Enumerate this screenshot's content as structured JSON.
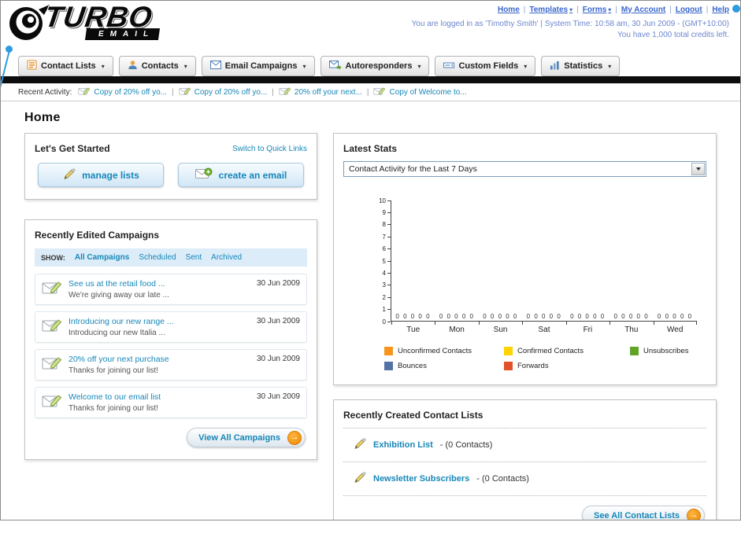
{
  "colors": {
    "accent": "#1787b8",
    "link_blue": "#3a66cc",
    "info_blue": "#6d86cf",
    "orange": "#f7941d",
    "bar_black": "#0d0d0d"
  },
  "header": {
    "logo_top": "TURBO",
    "logo_bottom": "EMAIL",
    "links": [
      {
        "label": "Home"
      },
      {
        "label": "Templates",
        "dropdown": true
      },
      {
        "label": "Forms",
        "dropdown": true
      },
      {
        "label": "My Account"
      },
      {
        "label": "Logout"
      },
      {
        "label": "Help"
      }
    ],
    "login_info": "You are logged in as 'Timothy Smith' | System Time: 10:58 am, 30 Jun 2009 - (GMT+10:00)",
    "credits": "You have 1,000 total credits left."
  },
  "nav": {
    "items": [
      {
        "label": "Contact Lists",
        "icon": "contact-lists-icon"
      },
      {
        "label": "Contacts",
        "icon": "contacts-icon"
      },
      {
        "label": "Email Campaigns",
        "icon": "email-campaigns-icon"
      },
      {
        "label": "Autoresponders",
        "icon": "autoresponders-icon"
      },
      {
        "label": "Custom Fields",
        "icon": "custom-fields-icon"
      },
      {
        "label": "Statistics",
        "icon": "statistics-icon"
      }
    ]
  },
  "activity": {
    "label": "Recent Activity:",
    "items": [
      "Copy of 20% off yo...",
      "Copy of 20% off yo...",
      "20% off your next...",
      "Copy of Welcome to..."
    ]
  },
  "page": {
    "title": "Home"
  },
  "get_started": {
    "title": "Let's Get Started",
    "switch_link": "Switch to Quick Links",
    "manage_lists_label": "manage lists",
    "create_email_label": "create an email"
  },
  "campaigns": {
    "title": "Recently Edited Campaigns",
    "show_label": "SHOW:",
    "tabs": [
      "All Campaigns",
      "Scheduled",
      "Sent",
      "Archived"
    ],
    "items": [
      {
        "title": "See us at the retail food ...",
        "subtitle": "We're giving away our late ...",
        "date": "30 Jun 2009"
      },
      {
        "title": "Introducing our new range ...",
        "subtitle": "Introducing our new Italia ...",
        "date": "30 Jun 2009"
      },
      {
        "title": "20% off your next purchase",
        "subtitle": "Thanks for joining our list!",
        "date": "30 Jun 2009"
      },
      {
        "title": "Welcome to our email list",
        "subtitle": "Thanks for joining our list!",
        "date": "30 Jun 2009"
      }
    ],
    "view_all_label": "View All Campaigns"
  },
  "stats": {
    "title": "Latest Stats",
    "dropdown_value": "Contact Activity for the Last 7 Days"
  },
  "chart_data": {
    "type": "bar",
    "title": "Contact Activity for the Last 7 Days",
    "categories": [
      "Tue",
      "Mon",
      "Sun",
      "Sat",
      "Fri",
      "Thu",
      "Wed"
    ],
    "series": [
      {
        "name": "Unconfirmed Contacts",
        "color": "#f7941d",
        "values": [
          0,
          0,
          0,
          0,
          0,
          0,
          0
        ]
      },
      {
        "name": "Confirmed Contacts",
        "color": "#ffd200",
        "values": [
          0,
          0,
          0,
          0,
          0,
          0,
          0
        ]
      },
      {
        "name": "Unsubscribes",
        "color": "#61a427",
        "values": [
          0,
          0,
          0,
          0,
          0,
          0,
          0
        ]
      },
      {
        "name": "Bounces",
        "color": "#5572a7",
        "values": [
          0,
          0,
          0,
          0,
          0,
          0,
          0
        ]
      },
      {
        "name": "Forwards",
        "color": "#e2512a",
        "values": [
          0,
          0,
          0,
          0,
          0,
          0,
          0
        ]
      }
    ],
    "ylim": [
      0,
      10
    ],
    "xlabel": "",
    "ylabel": "",
    "grid": false,
    "legend_position": "bottom",
    "value_labels_shown": true
  },
  "contact_lists": {
    "title": "Recently Created Contact Lists",
    "items": [
      {
        "name": "Exhibition List",
        "detail": "- (0 Contacts)"
      },
      {
        "name": "Newsletter Subscribers",
        "detail": "- (0 Contacts)"
      }
    ],
    "see_all_label": "See All Contact Lists"
  }
}
